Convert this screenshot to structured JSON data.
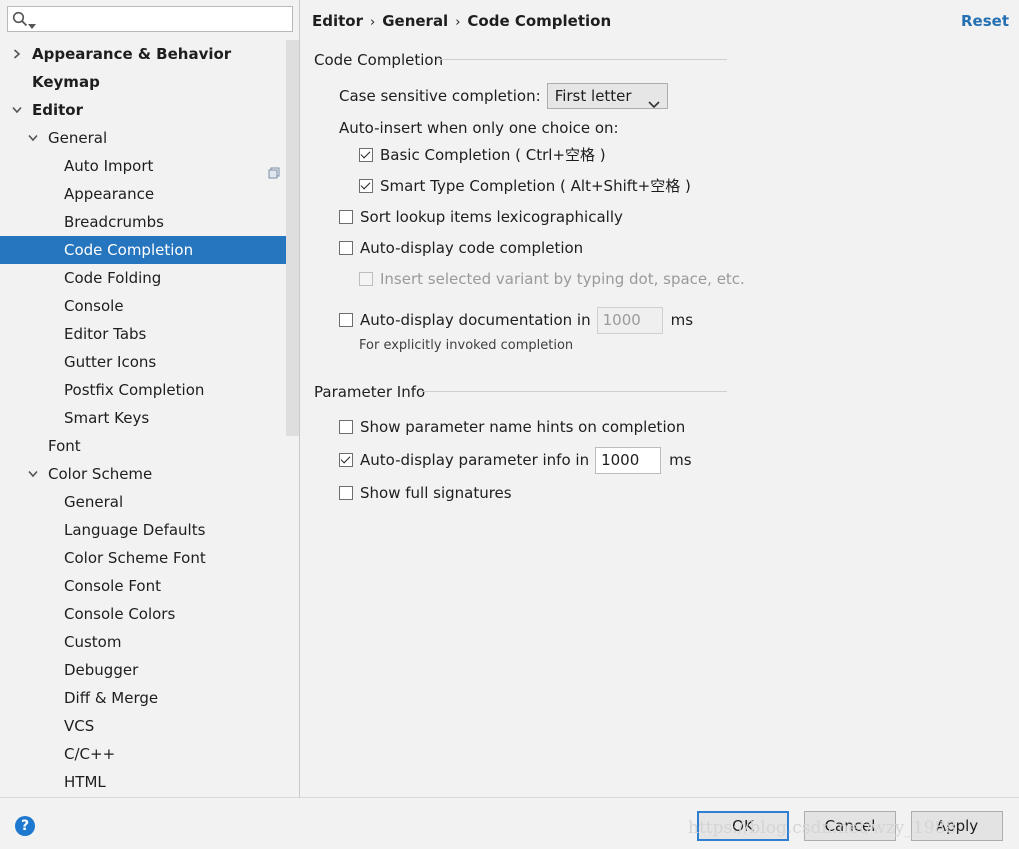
{
  "search": {
    "placeholder": ""
  },
  "sidebar": {
    "items": [
      {
        "label": "Appearance & Behavior",
        "level": 0,
        "arrow": "collapsed",
        "bold": true
      },
      {
        "label": "Keymap",
        "level": 0,
        "arrow": "none",
        "bold": true
      },
      {
        "label": "Editor",
        "level": 0,
        "arrow": "expanded",
        "bold": true
      },
      {
        "label": "General",
        "level": 1,
        "arrow": "expanded"
      },
      {
        "label": "Auto Import",
        "level": 2,
        "arrow": "none",
        "badge": "project-settings-icon"
      },
      {
        "label": "Appearance",
        "level": 2,
        "arrow": "none"
      },
      {
        "label": "Breadcrumbs",
        "level": 2,
        "arrow": "none"
      },
      {
        "label": "Code Completion",
        "level": 2,
        "arrow": "none",
        "selected": true
      },
      {
        "label": "Code Folding",
        "level": 2,
        "arrow": "none"
      },
      {
        "label": "Console",
        "level": 2,
        "arrow": "none"
      },
      {
        "label": "Editor Tabs",
        "level": 2,
        "arrow": "none"
      },
      {
        "label": "Gutter Icons",
        "level": 2,
        "arrow": "none"
      },
      {
        "label": "Postfix Completion",
        "level": 2,
        "arrow": "none"
      },
      {
        "label": "Smart Keys",
        "level": 2,
        "arrow": "none"
      },
      {
        "label": "Font",
        "level": 1,
        "arrow": "none"
      },
      {
        "label": "Color Scheme",
        "level": 1,
        "arrow": "expanded"
      },
      {
        "label": "General",
        "level": 2,
        "arrow": "none"
      },
      {
        "label": "Language Defaults",
        "level": 2,
        "arrow": "none"
      },
      {
        "label": "Color Scheme Font",
        "level": 2,
        "arrow": "none"
      },
      {
        "label": "Console Font",
        "level": 2,
        "arrow": "none"
      },
      {
        "label": "Console Colors",
        "level": 2,
        "arrow": "none"
      },
      {
        "label": "Custom",
        "level": 2,
        "arrow": "none"
      },
      {
        "label": "Debugger",
        "level": 2,
        "arrow": "none"
      },
      {
        "label": "Diff & Merge",
        "level": 2,
        "arrow": "none"
      },
      {
        "label": "VCS",
        "level": 2,
        "arrow": "none"
      },
      {
        "label": "C/C++",
        "level": 2,
        "arrow": "none"
      },
      {
        "label": "HTML",
        "level": 2,
        "arrow": "none"
      }
    ]
  },
  "header": {
    "breadcrumb": [
      "Editor",
      "General",
      "Code Completion"
    ],
    "reset_label": "Reset"
  },
  "code_completion": {
    "title": "Code Completion",
    "case_sensitive_label": "Case sensitive completion:",
    "case_sensitive_value": "First letter",
    "auto_insert_label": "Auto-insert when only one choice on:",
    "basic_completion": {
      "label": "Basic Completion ( Ctrl+空格 )",
      "checked": true
    },
    "smart_type_completion": {
      "label": "Smart Type Completion ( Alt+Shift+空格 )",
      "checked": true
    },
    "sort_lexicographically": {
      "label": "Sort lookup items lexicographically",
      "checked": false
    },
    "auto_display_code_completion": {
      "label": "Auto-display code completion",
      "checked": false
    },
    "insert_selected_variant": {
      "label": "Insert selected variant by typing dot, space, etc.",
      "checked": false,
      "disabled": true
    },
    "auto_display_documentation": {
      "label": "Auto-display documentation in",
      "checked": false,
      "value": "1000",
      "unit": "ms"
    },
    "documentation_note": "For explicitly invoked completion"
  },
  "parameter_info": {
    "title": "Parameter Info",
    "show_name_hints": {
      "label": "Show parameter name hints on completion",
      "checked": false
    },
    "auto_display_info": {
      "label": "Auto-display parameter info in",
      "checked": true,
      "value": "1000",
      "unit": "ms"
    },
    "show_full_signatures": {
      "label": "Show full signatures",
      "checked": false
    }
  },
  "footer": {
    "help_label": "?",
    "ok_label": "OK",
    "cancel_label": "Cancel",
    "apply_label": "Apply",
    "watermark": "https://blog.csdn.net/wzy_1988"
  },
  "colors": {
    "selection": "#2675bf",
    "link": "#2470b3",
    "default_button_border": "#2f7fd2"
  }
}
